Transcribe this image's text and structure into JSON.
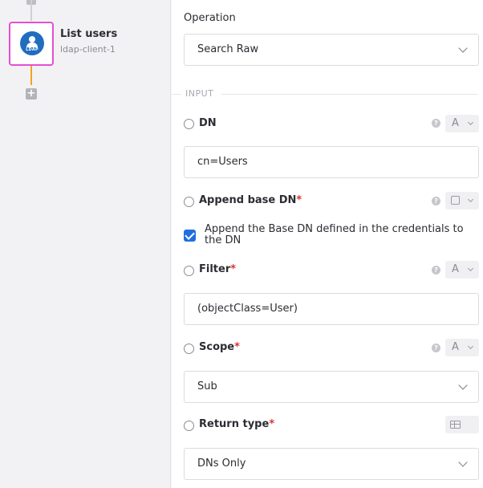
{
  "node": {
    "title": "List users",
    "subtitle": "ldap-client-1",
    "icon_text": "LDAP",
    "icon_name": "ldap-user-icon",
    "add_label": "+"
  },
  "form": {
    "operation_label": "Operation",
    "operation_value": "Search Raw",
    "section_input": "INPUT",
    "dn_label": "DN",
    "dn_value": "cn=Users",
    "dn_type": "A",
    "append_label": "Append base DN",
    "append_checkbox_text": "Append the Base DN defined in the credentials to the DN",
    "append_checked": true,
    "filter_label": "Filter",
    "filter_value": "(objectClass=User)",
    "filter_type": "A",
    "scope_label": "Scope",
    "scope_value": "Sub",
    "scope_type": "A",
    "return_label": "Return type",
    "return_value": "DNs Only",
    "required_mark": "*",
    "help_mark": "?"
  },
  "colors": {
    "accent": "#1f6fe0",
    "node_border": "#e64fd0",
    "connector": "#f4a21e",
    "required": "#e03030"
  }
}
